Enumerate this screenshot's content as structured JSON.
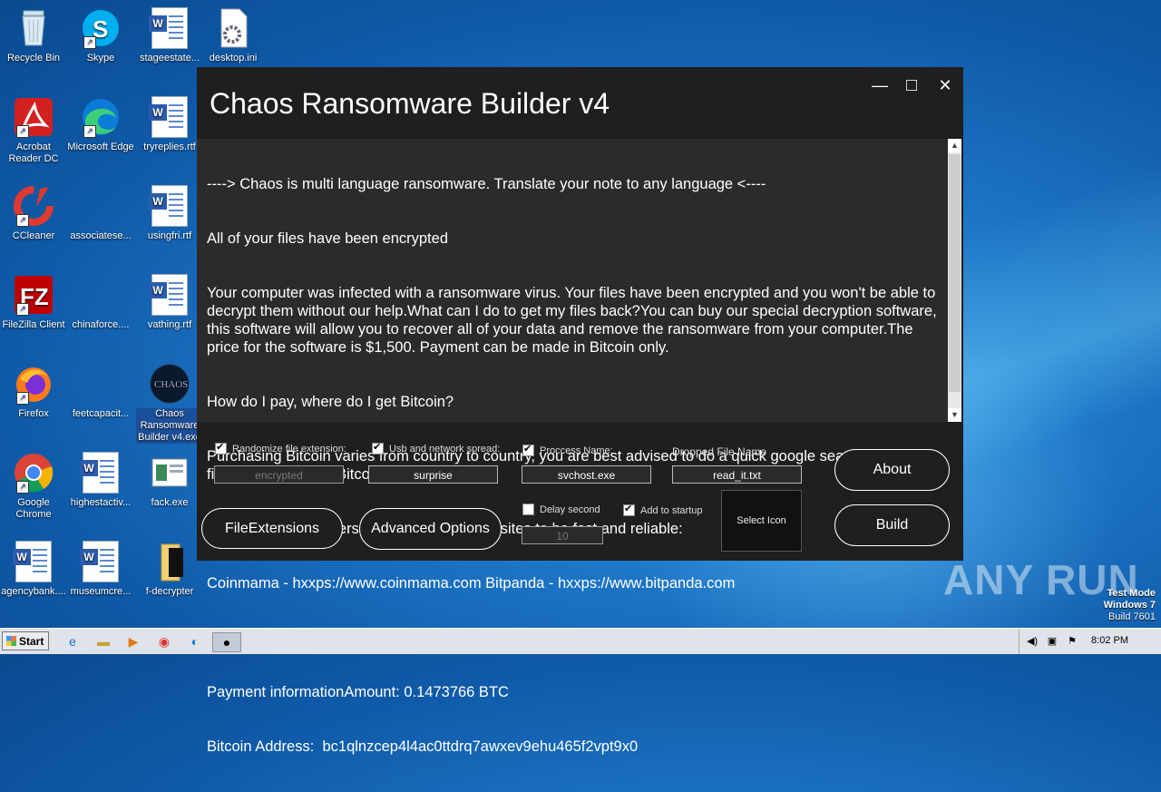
{
  "desktop": {
    "icons": [
      {
        "label": "Recycle Bin"
      },
      {
        "label": "Skype"
      },
      {
        "label": "stageestate..."
      },
      {
        "label": "desktop.ini"
      },
      {
        "label": "Acrobat Reader DC"
      },
      {
        "label": "Microsoft Edge"
      },
      {
        "label": "tryreplies.rtf"
      },
      {
        "label": "CCleaner"
      },
      {
        "label": "associatese..."
      },
      {
        "label": "usingfri.rtf"
      },
      {
        "label": "FileZilla Client"
      },
      {
        "label": "chinaforce...."
      },
      {
        "label": "vathing.rtf"
      },
      {
        "label": "Firefox"
      },
      {
        "label": "feetcapacit..."
      },
      {
        "label": "Chaos Ransomware Builder v4.exe"
      },
      {
        "label": "Google Chrome"
      },
      {
        "label": "highestactiv..."
      },
      {
        "label": "fack.exe"
      },
      {
        "label": "agencybank...."
      },
      {
        "label": "museumcre..."
      },
      {
        "label": "f-decrypter"
      }
    ],
    "watermark": "ANY RUN",
    "test_mode": {
      "line1": "Test Mode",
      "line2": "Windows 7",
      "line3": "Build 7601"
    }
  },
  "window": {
    "title": "Chaos Ransomware Builder v4",
    "controls": {
      "minimize": "—",
      "maximize": "□",
      "close": "✕"
    },
    "note_lines": [
      "----> Chaos is multi language ransomware. Translate your note to any language <----",
      "All of your files have been encrypted",
      "Your computer was infected with a ransomware virus. Your files have been encrypted and you won't be able to decrypt them without our help.What can I do to get my files back?You can buy our special decryption software, this software will allow you to recover all of your data and remove the ransomware from your computer.The price for the software is $1,500. Payment can be made in Bitcoin only.",
      "How do I pay, where do I get Bitcoin?",
      "Purchasing Bitcoin varies from country to country, you are best advised to do a quick google search yourself  to find out how to buy Bitcoin.",
      "Many of our customers have reported these sites to be fast and reliable:",
      "Coinmama - hxxps://www.coinmama.com Bitpanda - hxxps://www.bitpanda.com",
      "",
      "Payment informationAmount: 0.1473766 BTC",
      "Bitcoin Address:  bc1qlnzcep4l4ac0ttdrq7awxev9ehu465f2vpt9x0"
    ],
    "options": {
      "randomize": {
        "label": "Randomize file extension:",
        "checked": true,
        "value": "encrypted"
      },
      "usb": {
        "label": "Usb and network spread:",
        "checked": true,
        "value": "surprise"
      },
      "process": {
        "label": "Proccess Name:",
        "checked": true,
        "value": "svchost.exe"
      },
      "dropped": {
        "label": "Dropped File Name",
        "value": "read_it.txt"
      },
      "delay": {
        "label": "Delay second",
        "checked": false,
        "value": "10"
      },
      "startup": {
        "label": "Add to startup",
        "checked": true
      }
    },
    "buttons": {
      "file_extensions": "FileExtensions",
      "advanced": "Advanced Options",
      "select_icon": "Select Icon",
      "about": "About",
      "build": "Build"
    }
  },
  "taskbar": {
    "start": "Start",
    "clock": "8:02 PM"
  }
}
